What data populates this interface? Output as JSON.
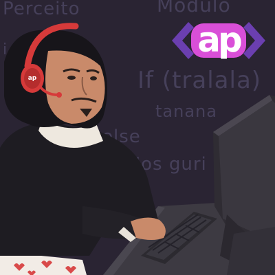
{
  "background_words": [
    "Perceito",
    "Modulo",
    "i",
    "If (tralala)",
    "tanana",
    "else",
    "é'os guri"
  ],
  "logo": {
    "text": "ap"
  },
  "headphone_logo": {
    "text": "ap"
  },
  "colors": {
    "background": "#2a2433",
    "chalk_text": "#46405a",
    "logo_purple": "#6b3fb0",
    "logo_pink": "#d94fd8",
    "headphones": "#d63a3a",
    "coat": "#1e1c22",
    "skin": "#c98a6a"
  },
  "icons": [
    "code-brackets-logo",
    "headphones-icon"
  ]
}
